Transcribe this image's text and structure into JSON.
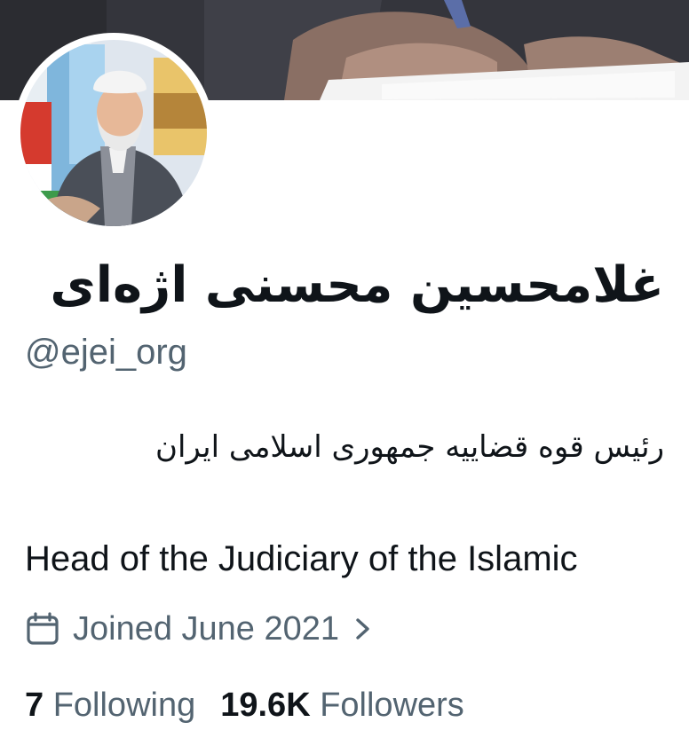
{
  "profile": {
    "display_name": "غلامحسین محسنی اژه‌ای",
    "handle": "@ejei_org",
    "bio_fa": "رئیس قوه قضاییه جمهوری اسلامی ایران",
    "bio_en": "Head of the Judiciary of the Islamic",
    "joined": "Joined June 2021",
    "following_count": "7",
    "following_label": "Following",
    "followers_count": "19.6K",
    "followers_label": "Followers"
  },
  "icons": {
    "calendar": "calendar-icon",
    "chevron": "chevron-right-icon"
  },
  "colors": {
    "text_primary": "#0f1419",
    "text_secondary": "#536471",
    "background": "#ffffff"
  }
}
